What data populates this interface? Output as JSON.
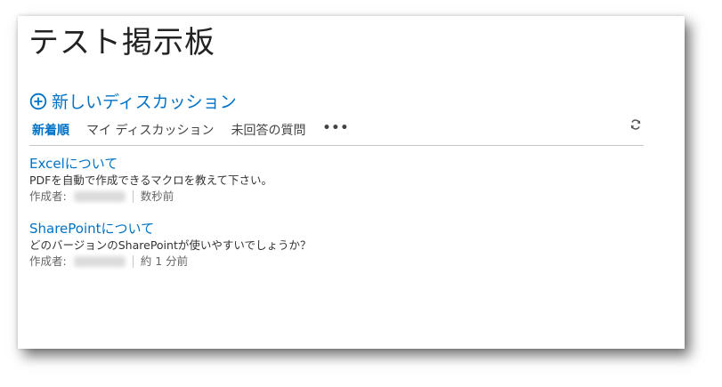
{
  "page": {
    "title": "テスト掲示板"
  },
  "toolbar": {
    "new_discussion_label": "新しいディスカッション"
  },
  "tabs": [
    {
      "label": "新着順",
      "active": true
    },
    {
      "label": "マイ ディスカッション",
      "active": false
    },
    {
      "label": "未回答の質問",
      "active": false
    }
  ],
  "more_label": "•••",
  "posts": [
    {
      "title": "Excelについて",
      "body": "PDFを自動で作成できるマクロを教えて下さい。",
      "author_label": "作成者:",
      "time": "数秒前"
    },
    {
      "title": "SharePointについて",
      "body": "どのバージョンのSharePointが使いやすいでしょうか？",
      "author_label": "作成者:",
      "time": "約 1 分前"
    }
  ],
  "colors": {
    "accent": "#0072c6",
    "text": "#333333",
    "muted": "#666666",
    "divider": "#c6c6c6"
  },
  "icons": {
    "add": "plus-circle-icon",
    "refresh": "refresh-icon",
    "more": "ellipsis-icon"
  }
}
